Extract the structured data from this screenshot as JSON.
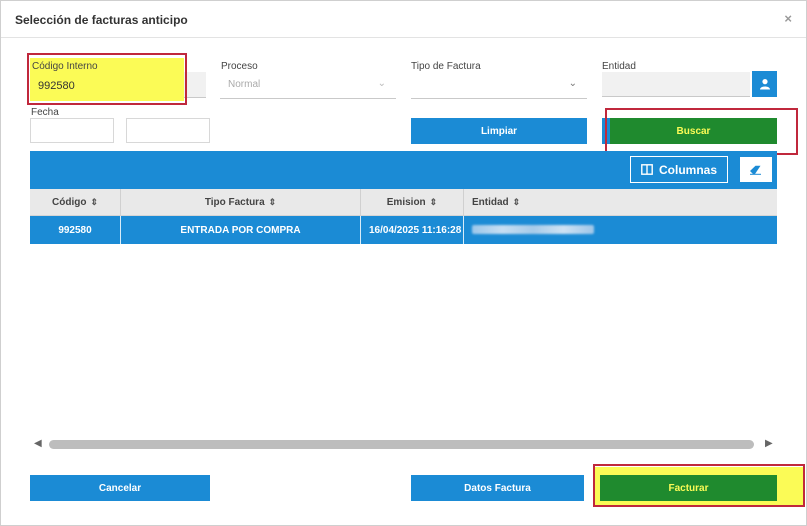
{
  "dialog": {
    "title": "Selección de facturas anticipo",
    "close_label": "×"
  },
  "filters": {
    "codigo_interno": {
      "label": "Código Interno",
      "value": "992580"
    },
    "proceso": {
      "label": "Proceso",
      "value": "Normal"
    },
    "tipo_factura": {
      "label": "Tipo de Factura",
      "value": ""
    },
    "entidad": {
      "label": "Entidad",
      "value": ""
    },
    "fecha": {
      "label": "Fecha",
      "from": "",
      "to": ""
    }
  },
  "buttons": {
    "limpiar": "Limpiar",
    "buscar": "Buscar",
    "columnas": "Columnas",
    "cancelar": "Cancelar",
    "datos_factura": "Datos Factura",
    "facturar": "Facturar"
  },
  "grid": {
    "columns": [
      "Código",
      "Tipo Factura",
      "Emision",
      "Entidad"
    ],
    "rows": [
      {
        "codigo": "992580",
        "tipo_factura": "ENTRADA POR COMPRA",
        "emision": "16/04/2025 11:16:28",
        "entidad": ""
      }
    ]
  },
  "icons": {
    "sort": "⇕",
    "chevron": "⌄",
    "columns": "columns-icon",
    "eraser": "eraser-icon",
    "user": "user-icon"
  },
  "colors": {
    "accent": "#1b8bd5",
    "primary_action": "#1f8a2e",
    "highlight": "#fbfb56",
    "annotation": "#c0283c"
  }
}
